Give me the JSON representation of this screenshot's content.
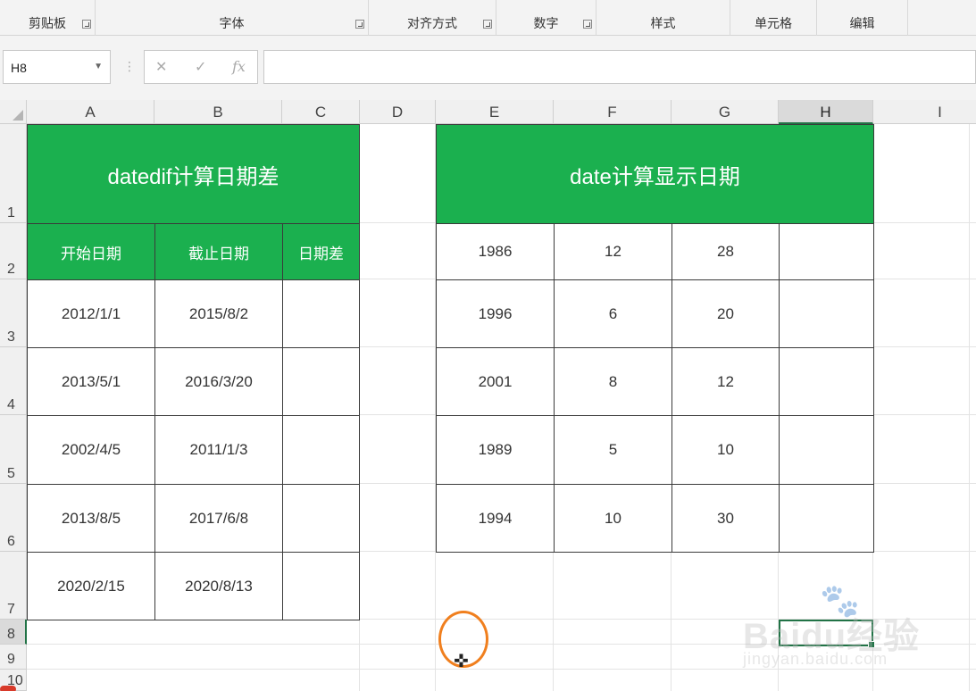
{
  "ribbon": {
    "groups": [
      {
        "label": "剪贴板",
        "launcher": true
      },
      {
        "label": "字体",
        "launcher": true
      },
      {
        "label": "对齐方式",
        "launcher": true
      },
      {
        "label": "数字",
        "launcher": true
      },
      {
        "label": "样式",
        "launcher": false
      },
      {
        "label": "单元格",
        "launcher": false
      },
      {
        "label": "编辑",
        "launcher": false
      }
    ]
  },
  "formula_bar": {
    "name_box": "H8",
    "cancel_icon": "✕",
    "enter_icon": "✓",
    "fx_label": "fx",
    "formula": ""
  },
  "grid": {
    "columns": [
      "A",
      "B",
      "C",
      "D",
      "E",
      "F",
      "G",
      "H",
      "I"
    ],
    "rows": [
      "1",
      "2",
      "3",
      "4",
      "5",
      "6",
      "7",
      "8",
      "9",
      "10"
    ],
    "selected_column": "H",
    "selected_row": "8"
  },
  "left_table": {
    "title": "datedif计算日期差",
    "headers": [
      "开始日期",
      "截止日期",
      "日期差"
    ],
    "rows": [
      [
        "2012/1/1",
        "2015/8/2",
        ""
      ],
      [
        "2013/5/1",
        "2016/3/20",
        ""
      ],
      [
        "2002/4/5",
        "2011/1/3",
        ""
      ],
      [
        "2013/8/5",
        "2017/6/8",
        ""
      ],
      [
        "2020/2/15",
        "2020/8/13",
        ""
      ]
    ]
  },
  "right_table": {
    "title": "date计算显示日期",
    "rows": [
      [
        "1986",
        "12",
        "28",
        ""
      ],
      [
        "1996",
        "6",
        "20",
        ""
      ],
      [
        "2001",
        "8",
        "12",
        ""
      ],
      [
        "1989",
        "5",
        "10",
        ""
      ],
      [
        "1994",
        "10",
        "30",
        ""
      ]
    ]
  },
  "watermark": {
    "paw": "🐾",
    "logo": "Baidu经验",
    "url": "jingyan.baidu.com"
  },
  "colors": {
    "header_green": "#1bb04f",
    "selection_green": "#217346",
    "cursor_ring": "#f07f1e"
  }
}
